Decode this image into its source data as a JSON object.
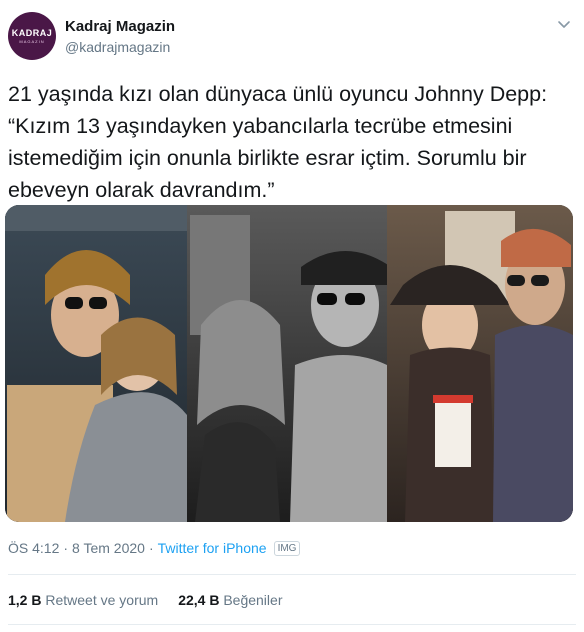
{
  "account": {
    "display_name": "Kadraj Magazin",
    "handle": "@kadrajmagazin",
    "avatar_text": "KADRAJ",
    "avatar_subtext": "MAGAZIN"
  },
  "tweet": {
    "text": "21 yaşında kızı olan dünyaca ünlü oyuncu Johnny Depp: “Kızım 13 yaşındayken yabancılarla tecrübe etmesini istemediğim için onunla birlikte esrar içtim. Sorumlu bir ebeveyn olarak davrandım.”"
  },
  "meta": {
    "time": "ÖS 4:12",
    "date": "8 Tem 2020",
    "separator": "·",
    "source": "Twitter for iPhone",
    "img_badge": "IMG"
  },
  "stats": {
    "retweets_count": "1,2 B",
    "retweets_label": "Retweet ve yorum",
    "likes_count": "22,4 B",
    "likes_label": "Beğeniler"
  },
  "icons": {
    "caret": "chevron-down-icon"
  },
  "colors": {
    "avatar_bg": "#4a1747",
    "link": "#1da1f2",
    "muted": "#657786",
    "text": "#14171a"
  }
}
